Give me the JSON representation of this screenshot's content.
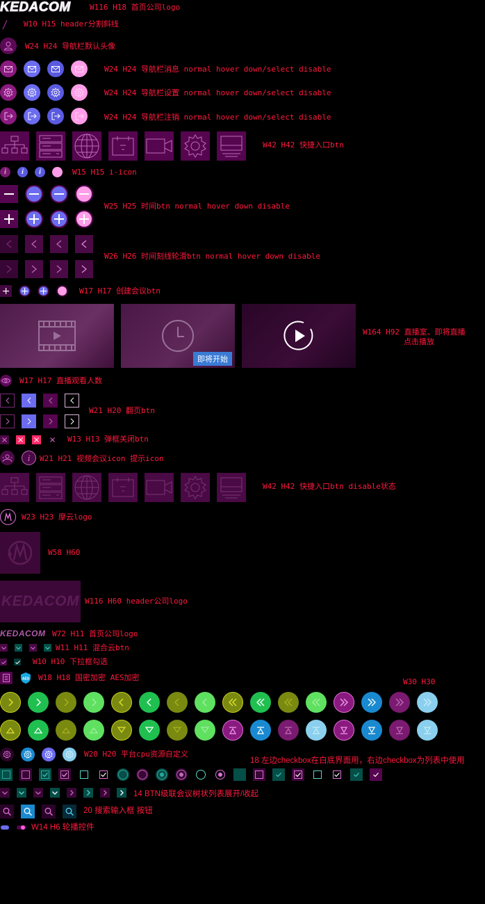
{
  "colors": {
    "label": "#ff1a3d",
    "magenta": "#a0239a",
    "purple_dark": "#56054f",
    "blue": "#6a6cf0",
    "pink": "#ff9de8",
    "green": "#26d36b",
    "olive": "#8a9a14",
    "cyan": "#2ab4e8"
  },
  "logos": {
    "main_text": "KEDACOM",
    "header_text": "KEDACOM",
    "small_text": "KEDACOM"
  },
  "labels": {
    "l01": "W116 H18 首页公司logo",
    "l02": "W10 H15 header分割斜线",
    "l03": "W24 H24 导航栏默认头像",
    "l04": "W24 H24 导航栏消息 normal hover down/select disable",
    "l05": "W24 H24 导航栏设置 normal hover down/select disable",
    "l06": "W24 H24 导航栏注销 normal hover down/select disable",
    "l07": "W42 H42 快捷入口btn",
    "l08": "W15 H15 i-icon",
    "l09": "W25 H25 时间btn normal hover down disable",
    "l10": "W26 H26 时间刻线轮滑btn normal hover down disable",
    "l11": "W17 H17 创建会议btn",
    "l12a": "W164 H92 直播室、即将直播",
    "l12b": "点击播放",
    "l13": "W17 H17 直播观看人数",
    "l14": "W21 H20 翻页btn",
    "l15": "W13 H13 弹框关闭btn",
    "l16": "W21 H21 视频会议icon 提示icon",
    "l17": "W42 H42 快捷入口btn disable状态",
    "l18": "W23 H23 摩云logo",
    "l19": "W58 H60",
    "l20": "W116 H60 header公司logo",
    "l21": "W72 H11 首页公司logo",
    "l22": "W11 H11 混合云btn",
    "l23": "W10 H10 下拉框勾选",
    "l24": "W18 H18 国密加密 AES加密",
    "l25": "W30 H30",
    "l26": "W20 H20 平台cpu资源自定义",
    "l27": "18 左边checkbox在白底界面用，右边checkbox为列表中使用",
    "l28": "14 BTN级联会议树状列表展开/收起",
    "l29": "20 搜索输入框 按钮",
    "l30": "W14 H6 轮播控件"
  },
  "thumbnails": {
    "badge": "即将开始"
  },
  "icons": {
    "avatar": "user-icon",
    "message": "envelope-icon",
    "settings": "gear-icon",
    "logout": "logout-icon",
    "info": "info-icon",
    "minus": "minus-icon",
    "plus": "plus-icon",
    "left": "chevron-left-icon",
    "right": "chevron-right-icon",
    "eye": "eye-icon",
    "close": "close-icon",
    "search": "search-icon",
    "aes": "AES"
  }
}
